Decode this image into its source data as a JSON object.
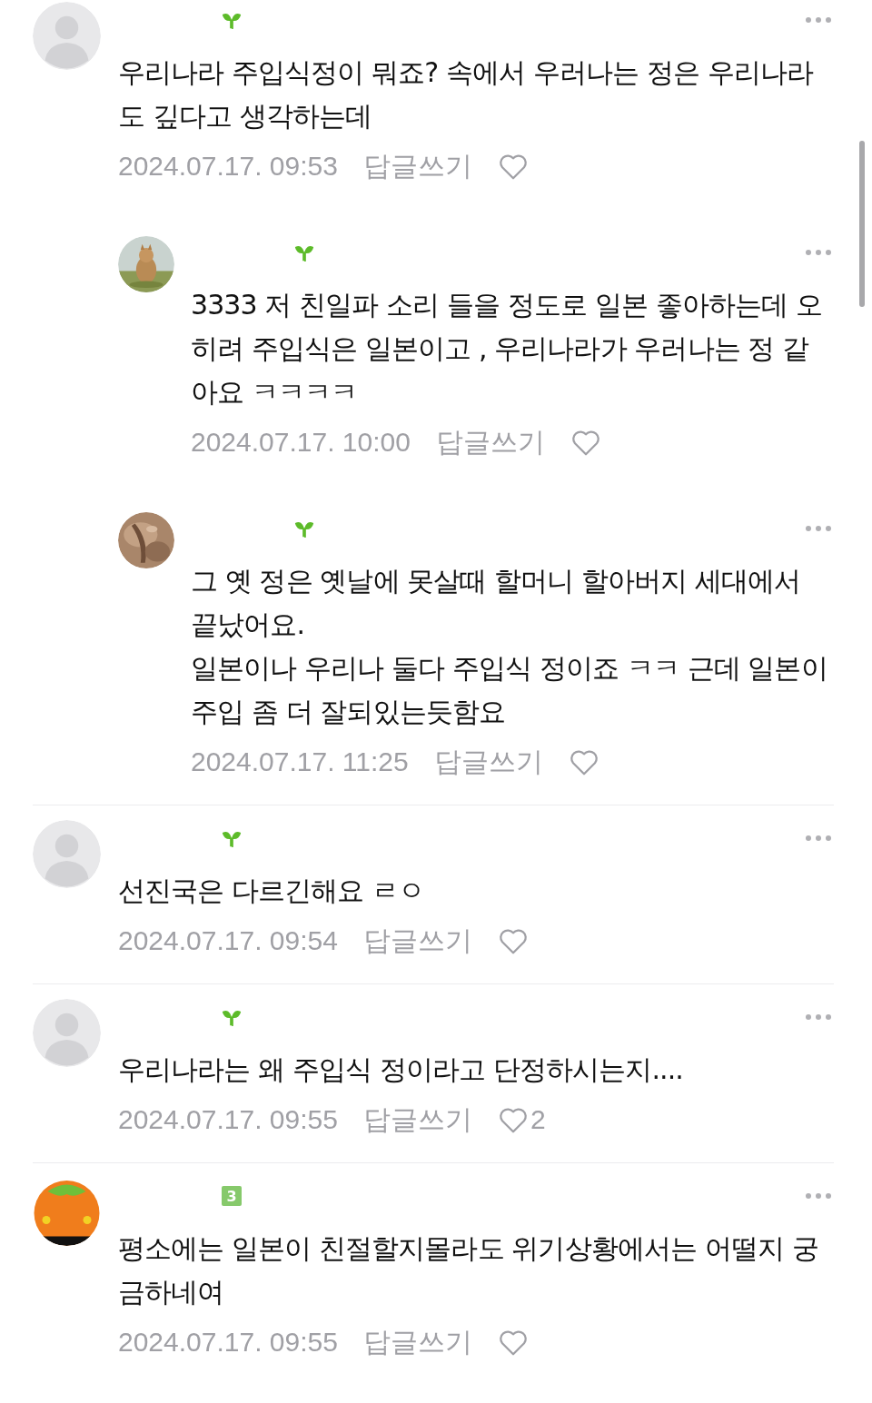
{
  "comments": [
    {
      "avatar": {
        "kind": "default"
      },
      "badge": {
        "kind": "sprout"
      },
      "text": "우리나라 주입식정이 뭐죠? 속에서 우러나는 정은 우리나라도 깊다고 생각하는데",
      "date": "2024.07.17. 09:53",
      "reply_label": "답글쓰기",
      "children": [
        {
          "avatar": {
            "kind": "animal"
          },
          "badge": {
            "kind": "sprout"
          },
          "text": "3333 저 친일파 소리 들을 정도로 일본 좋아하는데 오히려 주입식은 일본이고 , 우리나라가 우러나는 정 같아요 ㅋㅋㅋㅋ",
          "date": "2024.07.17. 10:00",
          "reply_label": "답글쓰기"
        },
        {
          "avatar": {
            "kind": "texture"
          },
          "badge": {
            "kind": "sprout"
          },
          "text": "그 옛 정은 옛날에 못살때 할머니 할아버지 세대에서 끝났어요.\n일본이나 우리나 둘다 주입식 정이죠 ㅋㅋ 근데 일본이 주입 좀 더 잘되있는듯함요",
          "date": "2024.07.17. 11:25",
          "reply_label": "답글쓰기"
        }
      ]
    },
    {
      "avatar": {
        "kind": "default"
      },
      "badge": {
        "kind": "sprout"
      },
      "text": "선진국은 다르긴해요 ㄹㅇ",
      "date": "2024.07.17. 09:54",
      "reply_label": "답글쓰기"
    },
    {
      "avatar": {
        "kind": "default"
      },
      "badge": {
        "kind": "sprout"
      },
      "text": "우리나라는 왜 주입식 정이라고 단정하시는지....",
      "date": "2024.07.17. 09:55",
      "reply_label": "답글쓰기",
      "like_count": "2"
    },
    {
      "avatar": {
        "kind": "fruit"
      },
      "badge": {
        "kind": "level",
        "text": "3"
      },
      "text": "평소에는 일본이 친절할지몰라도 위기상황에서는 어떨지 궁금하네여",
      "date": "2024.07.17. 09:55",
      "reply_label": "답글쓰기"
    }
  ]
}
